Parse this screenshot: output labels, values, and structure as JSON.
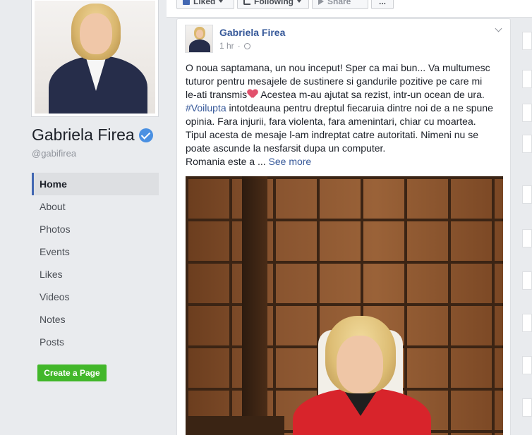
{
  "page": {
    "name": "Gabriela Firea",
    "handle": "@gabifirea"
  },
  "nav": {
    "items": [
      {
        "label": "Home",
        "active": true
      },
      {
        "label": "About"
      },
      {
        "label": "Photos"
      },
      {
        "label": "Events"
      },
      {
        "label": "Likes"
      },
      {
        "label": "Videos"
      },
      {
        "label": "Notes"
      },
      {
        "label": "Posts"
      }
    ]
  },
  "create_page": {
    "label": "Create a Page"
  },
  "action_bar": {
    "liked": "Liked",
    "following": "Following",
    "share": "Share",
    "more": "..."
  },
  "post": {
    "author": "Gabriela Firea",
    "time": "1 hr",
    "lines": [
      "O noua saptamana, un nou inceput! Sper ca mai bun... Va multumesc",
      "tuturor pentru mesajele de sustinere si gandurile pozitive pe care mi",
      "le-ati transmis",
      " Acestea m-au ajutat sa rezist, intr-un ocean de ura.",
      "#Voilupta",
      " intotdeauna pentru dreptul fiecaruia dintre noi de a ne spune",
      "opinia. Fara injurii, fara violenta, fara amenintari, chiar cu moartea.",
      "Tipul acesta de mesaje l-am indreptat catre autoritati. Nimeni nu se",
      "poate ascunde la nesfarsit dupa un computer.",
      "Romania este a ... "
    ],
    "see_more": "See more"
  },
  "colors": {
    "link": "#365899",
    "create_button": "#42b72a",
    "verified": "#4a90e2"
  }
}
